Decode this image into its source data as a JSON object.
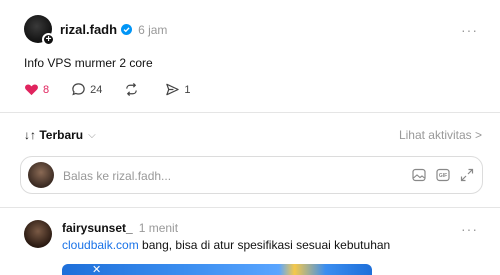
{
  "post": {
    "username": "rizal.fadh",
    "time": "6 jam",
    "text": "Info VPS murmer 2 core",
    "likes": "8",
    "comments": "24",
    "shares": "1"
  },
  "sort": {
    "label": "↓↑ Terbaru",
    "activity_link": "Lihat aktivitas >"
  },
  "reply_input": {
    "placeholder": "Balas ke rizal.fadh..."
  },
  "reply": {
    "username": "fairysunset_",
    "time": "1 menit",
    "link_text": "cloudbaik.com",
    "text": " bang, bisa di atur spesifikasi sesuai kebutuhan"
  },
  "colors": {
    "heart": "#e0245e",
    "link": "#1a73e8",
    "verified": "#0095f6"
  }
}
